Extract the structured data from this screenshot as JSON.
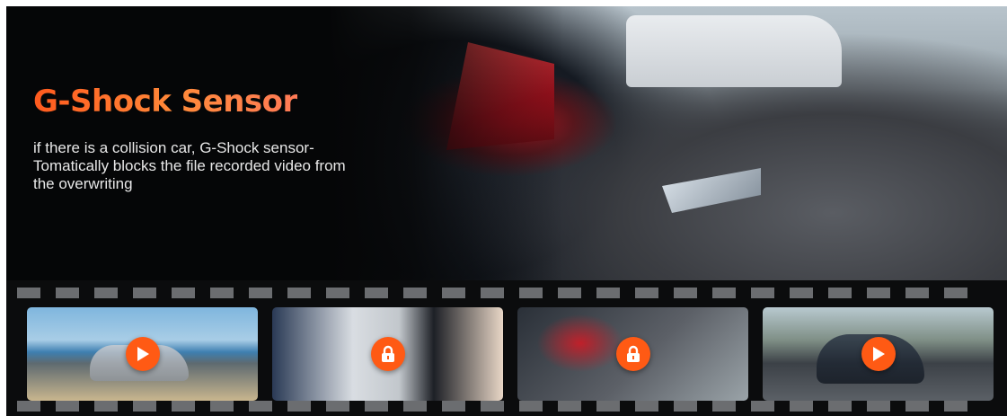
{
  "hero": {
    "title": "G-Shock Sensor",
    "description": "if there is a collision car, G-Shock sensor-Tomatically blocks the file recorded video from the overwriting"
  },
  "colors": {
    "accent": "#ff5a14",
    "background": "#050607",
    "perforation": "#6b6d70"
  },
  "film_strip": {
    "frames": [
      {
        "subject": "silver car on coastal road",
        "icon": "play-icon"
      },
      {
        "subject": "two people inspecting collision damage",
        "icon": "lock-icon"
      },
      {
        "subject": "rear-end collision close-up",
        "icon": "lock-icon"
      },
      {
        "subject": "dark sedan driving on highway",
        "icon": "play-icon"
      }
    ]
  }
}
